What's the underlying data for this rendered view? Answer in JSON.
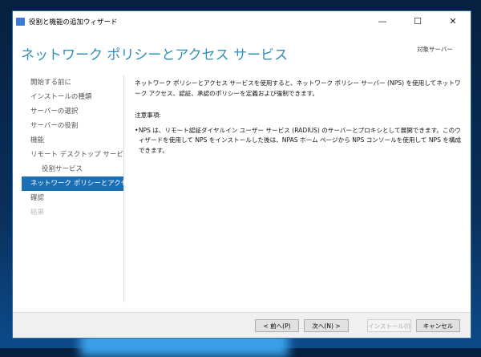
{
  "window": {
    "title": "役割と機能の追加ウィザード",
    "minimize": "—",
    "maximize": "☐",
    "close": "✕"
  },
  "header": {
    "title": "ネットワーク ポリシーとアクセス サービス",
    "target_server": "対象サーバー"
  },
  "sidebar": {
    "items": [
      {
        "label": "開始する前に"
      },
      {
        "label": "インストールの種類"
      },
      {
        "label": "サーバーの選択"
      },
      {
        "label": "サーバーの役割"
      },
      {
        "label": "機能"
      },
      {
        "label": "リモート デスクトップ サービス"
      },
      {
        "label": "役割サービス"
      },
      {
        "label": "ネットワーク ポリシーとアクセ..."
      },
      {
        "label": "確認"
      },
      {
        "label": "結果"
      }
    ]
  },
  "content": {
    "intro": "ネットワーク ポリシーとアクセス サービスを使用すると、ネットワーク ポリシー サーバー (NPS) を使用してネットワーク アクセス、認証、承認のポリシーを定義および強制できます。",
    "notes_heading": "注意事項:",
    "bullet": "•",
    "note": "NPS は、リモート認証ダイヤルイン ユーザー サービス (RADIUS) のサーバーとプロキシとして展開できます。このウィザードを使用して NPS をインストールした後は、NPAS ホーム ページから NPS コンソールを使用して NPS を構成できます。"
  },
  "footer": {
    "prev": "< 前へ(P)",
    "next": "次へ(N) >",
    "install": "インストール(I)",
    "cancel": "キャンセル"
  }
}
